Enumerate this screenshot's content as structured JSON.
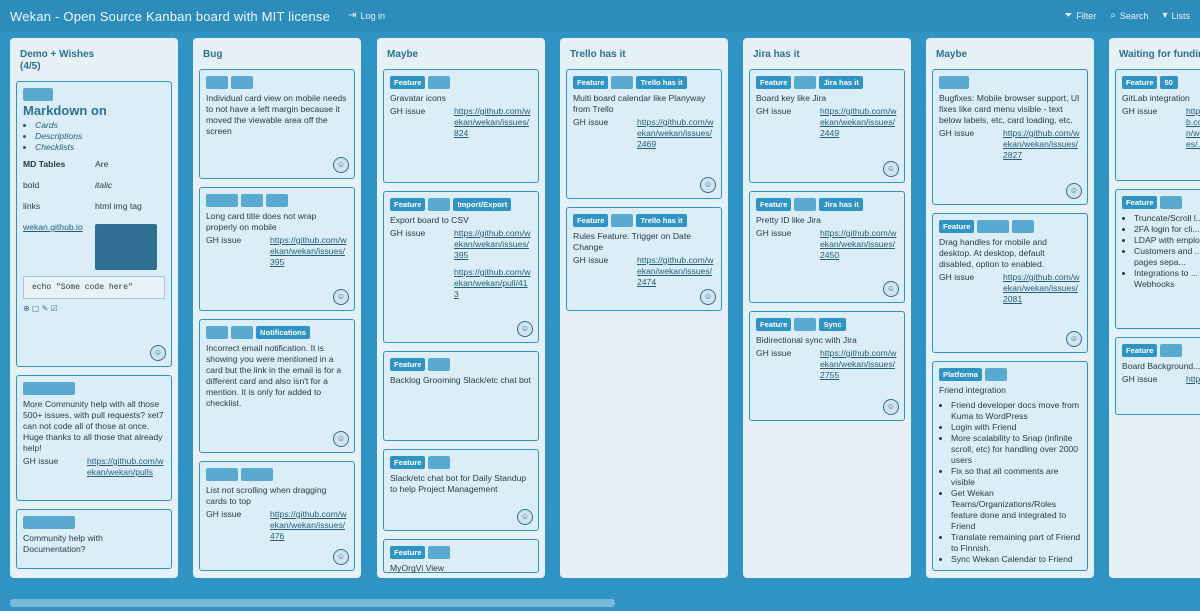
{
  "header": {
    "title": "Wekan - Open Source Kanban board with MIT license",
    "login": "Log in",
    "filter": "Filter",
    "search": "Search",
    "lists": "Lists",
    "icons": [
      "login-icon",
      "filter-icon",
      "search-icon",
      "lists-icon"
    ]
  },
  "lists": [
    {
      "title": "Demo + Wishes\n(4/5)",
      "cards": [
        {
          "md": {
            "title": "Markdown on",
            "items": [
              "Cards",
              "Descriptions",
              "Checklists"
            ],
            "table": [
              [
                "MD Tables",
                "Are"
              ],
              [
                "bold",
                "italic"
              ],
              [
                "links",
                "html img tag"
              ],
              [
                "wekan.github.io",
                ""
              ]
            ],
            "code": "echo \"Some code here\""
          }
        },
        {
          "labels": [
            "",
            ""
          ],
          "text": "More Community help with all those 500+ issues, with pull requests? xet7 can not code all of those at once. Huge thanks to all those that already help!",
          "gh": "GH issue",
          "link": "https://github.com/wekan/wekan/pulls"
        },
        {
          "labels": [
            ""
          ],
          "text": "Community help with Documentation?"
        }
      ]
    },
    {
      "title": "Bug",
      "cards": [
        {
          "labels": [
            "",
            ""
          ],
          "text": "Individual card view on mobile needs to not have a left margin because it moved the viewable area off the screen"
        },
        {
          "labels": [
            "",
            "",
            ""
          ],
          "text": "Long card title does not wrap properly on mobile",
          "gh": "GH issue",
          "link": "https://github.com/wekan/wekan/issues/395"
        },
        {
          "labels": [
            "",
            "",
            "Notifications"
          ],
          "text": "Incorrect email notification. It is showing you were mentioned in a card but the link in the email is for a different card and also isn't for a mention. It is only for added to checklist."
        },
        {
          "labels": [
            "",
            ""
          ],
          "text": "List not scrolling when dragging cards to top",
          "gh": "GH issue",
          "link": "https://github.com/wekan/wekan/issues/476"
        }
      ]
    },
    {
      "title": "Maybe",
      "cards": [
        {
          "labels": [
            "Feature",
            ""
          ],
          "text": "Gravatar icons",
          "gh": "GH issue",
          "link": "https://github.com/wekan/wekan/issues/824"
        },
        {
          "labels": [
            "Feature",
            "",
            "Import/Export"
          ],
          "text": "Export board to CSV",
          "gh": "GH issue",
          "link": "https://github.com/wekan/wekan/issues/395",
          "link2": "https://github.com/wekan/wekan/pull/413"
        },
        {
          "labels": [
            "Feature",
            ""
          ],
          "text": "Backlog Grooming Slack/etc chat bot"
        },
        {
          "labels": [
            "Feature",
            ""
          ],
          "text": "Slack/etc chat bot for Daily Standup to help Project Management"
        },
        {
          "labels": [
            "Feature",
            ""
          ],
          "text": "MyOrgVi View"
        }
      ]
    },
    {
      "title": "Trello has it",
      "cards": [
        {
          "labels": [
            "Feature",
            "",
            "Trello has it"
          ],
          "text": "Multi board calendar like Planyway from Trello",
          "gh": "GH issue",
          "link": "https://github.com/wekan/wekan/issues/2469"
        },
        {
          "labels": [
            "Feature",
            "",
            "Trello has it"
          ],
          "text": "Rules Feature: Trigger on Date Change",
          "gh": "GH issue",
          "link": "https://github.com/wekan/wekan/issues/2474"
        }
      ]
    },
    {
      "title": "Jira has it",
      "cards": [
        {
          "labels": [
            "Feature",
            "",
            "Jira has it"
          ],
          "text": "Board key like Jira",
          "gh": "GH issue",
          "link": "https://github.com/wekan/wekan/issues/2449"
        },
        {
          "labels": [
            "Feature",
            "",
            "Jira has it"
          ],
          "text": "Pretty ID like Jira",
          "gh": "GH issue",
          "link": "https://github.com/wekan/wekan/issues/2450"
        },
        {
          "labels": [
            "Feature",
            "",
            "Sync"
          ],
          "text": "Bidirectional sync with Jira",
          "gh": "GH issue",
          "link": "https://github.com/wekan/wekan/issues/2755"
        }
      ]
    },
    {
      "title": "Maybe",
      "cards": [
        {
          "labels": [
            ""
          ],
          "text": "Bugfixes: Mobile browser support, UI fixes like card menu visible - text below labels, etc, card loading, etc.",
          "gh": "GH issue",
          "link": "https://github.com/wekan/wekan/issues/2827"
        },
        {
          "labels": [
            "Feature",
            "",
            ""
          ],
          "text": "Drag handles for mobile and desktop. At desktop, default disabled, option to enabled.",
          "gh": "GH issue",
          "link": "https://github.com/wekan/wekan/issues/2081"
        },
        {
          "labels": [
            "Platforma",
            ""
          ],
          "text": "Friend integration",
          "bullets": [
            "Friend developer docs move from Kuma to WordPress",
            "Login with Friend",
            "More scalability to Snap (infinite scroll, etc) for handling over 2000 users",
            "Fix so that all comments are visible",
            "Get Wekan Teams/Organizations/Roles feature done and integrated to Friend",
            "Translate remaining part of Friend to Finnish.",
            "Sync Wekan Calendar to Friend"
          ]
        }
      ]
    },
    {
      "title": "Waiting for funding",
      "cards": [
        {
          "labels": [
            "Feature",
            "50"
          ],
          "text": "GitLab integration",
          "gh": "GH issue",
          "link": "https://github.com/wekan/wekan/issues/..."
        },
        {
          "labels": [
            "Feature",
            ""
          ],
          "bullets": [
            "Truncate/Scroll l...",
            "2FA login for cli...",
            "LDAP with emplo...",
            "Customers and ... login pages sepa...",
            "Integrations to ... Webhooks"
          ]
        },
        {
          "labels": [
            "Feature",
            ""
          ],
          "text": "Board Background...",
          "gh": "GH issue",
          "link": "https://..."
        }
      ]
    }
  ]
}
